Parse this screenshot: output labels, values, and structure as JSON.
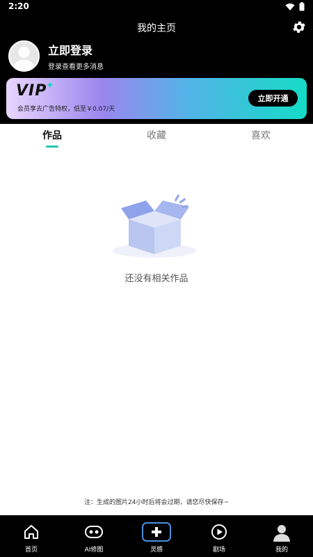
{
  "status_bar": {
    "time": "2:20"
  },
  "header": {
    "title": "我的主页",
    "login_title": "立即登录",
    "login_subtitle": "登录查看更多消息"
  },
  "vip": {
    "logo": "VIP",
    "description": "会员享去广告特权，低至￥0.07/天",
    "button": "立即开通"
  },
  "tabs": [
    {
      "label": "作品",
      "active": true
    },
    {
      "label": "收藏",
      "active": false
    },
    {
      "label": "喜欢",
      "active": false
    }
  ],
  "empty_state": {
    "text": "还没有相关作品"
  },
  "note": "注：生成的图片24小时后将会过期，请您尽快保存~",
  "bottom_nav": [
    {
      "label": "首页",
      "icon": "home-icon"
    },
    {
      "label": "AI修图",
      "icon": "gamepad-icon"
    },
    {
      "label": "灵感",
      "icon": "plus-icon"
    },
    {
      "label": "剧场",
      "icon": "play-icon"
    },
    {
      "label": "我的",
      "icon": "user-icon"
    }
  ],
  "colors": {
    "accent": "#21c6b5",
    "background_dark": "#000000",
    "vip_gradient_start": "#e9d6ff",
    "vip_gradient_end": "#15dcc7"
  }
}
